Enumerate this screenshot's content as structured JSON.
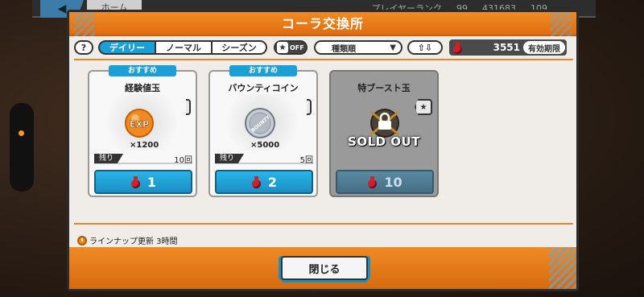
{
  "background": {
    "home_label": "ホーム",
    "player_rank_label": "プレイヤーランク",
    "player_rank_value": "99",
    "coins": "431683",
    "gems": "109"
  },
  "modal": {
    "title": "コーラ交換所",
    "help_label": "?",
    "tabs": [
      {
        "label": "デイリー",
        "active": true
      },
      {
        "label": "ノーマル",
        "active": false
      },
      {
        "label": "シーズン",
        "active": false
      }
    ],
    "favorite_toggle": "OFF",
    "sort_select": "種類順",
    "sort_direction": "⇧⇩",
    "currency_amount": "3551",
    "expire_button": "有効期限"
  },
  "cards": [
    {
      "badge": "おすすめ",
      "name": "経験値玉",
      "art_label": "EXP",
      "quantity": "×1200",
      "remain_label": "残り",
      "remain_value": "10回",
      "price": "1",
      "sold_out": false
    },
    {
      "badge": "おすすめ",
      "name": "バウンティコイン",
      "art_label": "BOUNTY",
      "quantity": "×5000",
      "remain_label": "残り",
      "remain_value": "5回",
      "price": "2",
      "sold_out": false
    },
    {
      "badge": "",
      "name": "特ブースト玉",
      "art_label": "",
      "quantity": "",
      "remain_label": "",
      "remain_value": "",
      "price": "10",
      "sold_out": true,
      "sold_out_text": "SOLD OUT"
    }
  ],
  "lineup_update": "ラインナップ更新 3時間",
  "close_button": "閉じる",
  "colors": {
    "accent_orange": "#e8801c",
    "accent_blue": "#1a9fd6"
  }
}
